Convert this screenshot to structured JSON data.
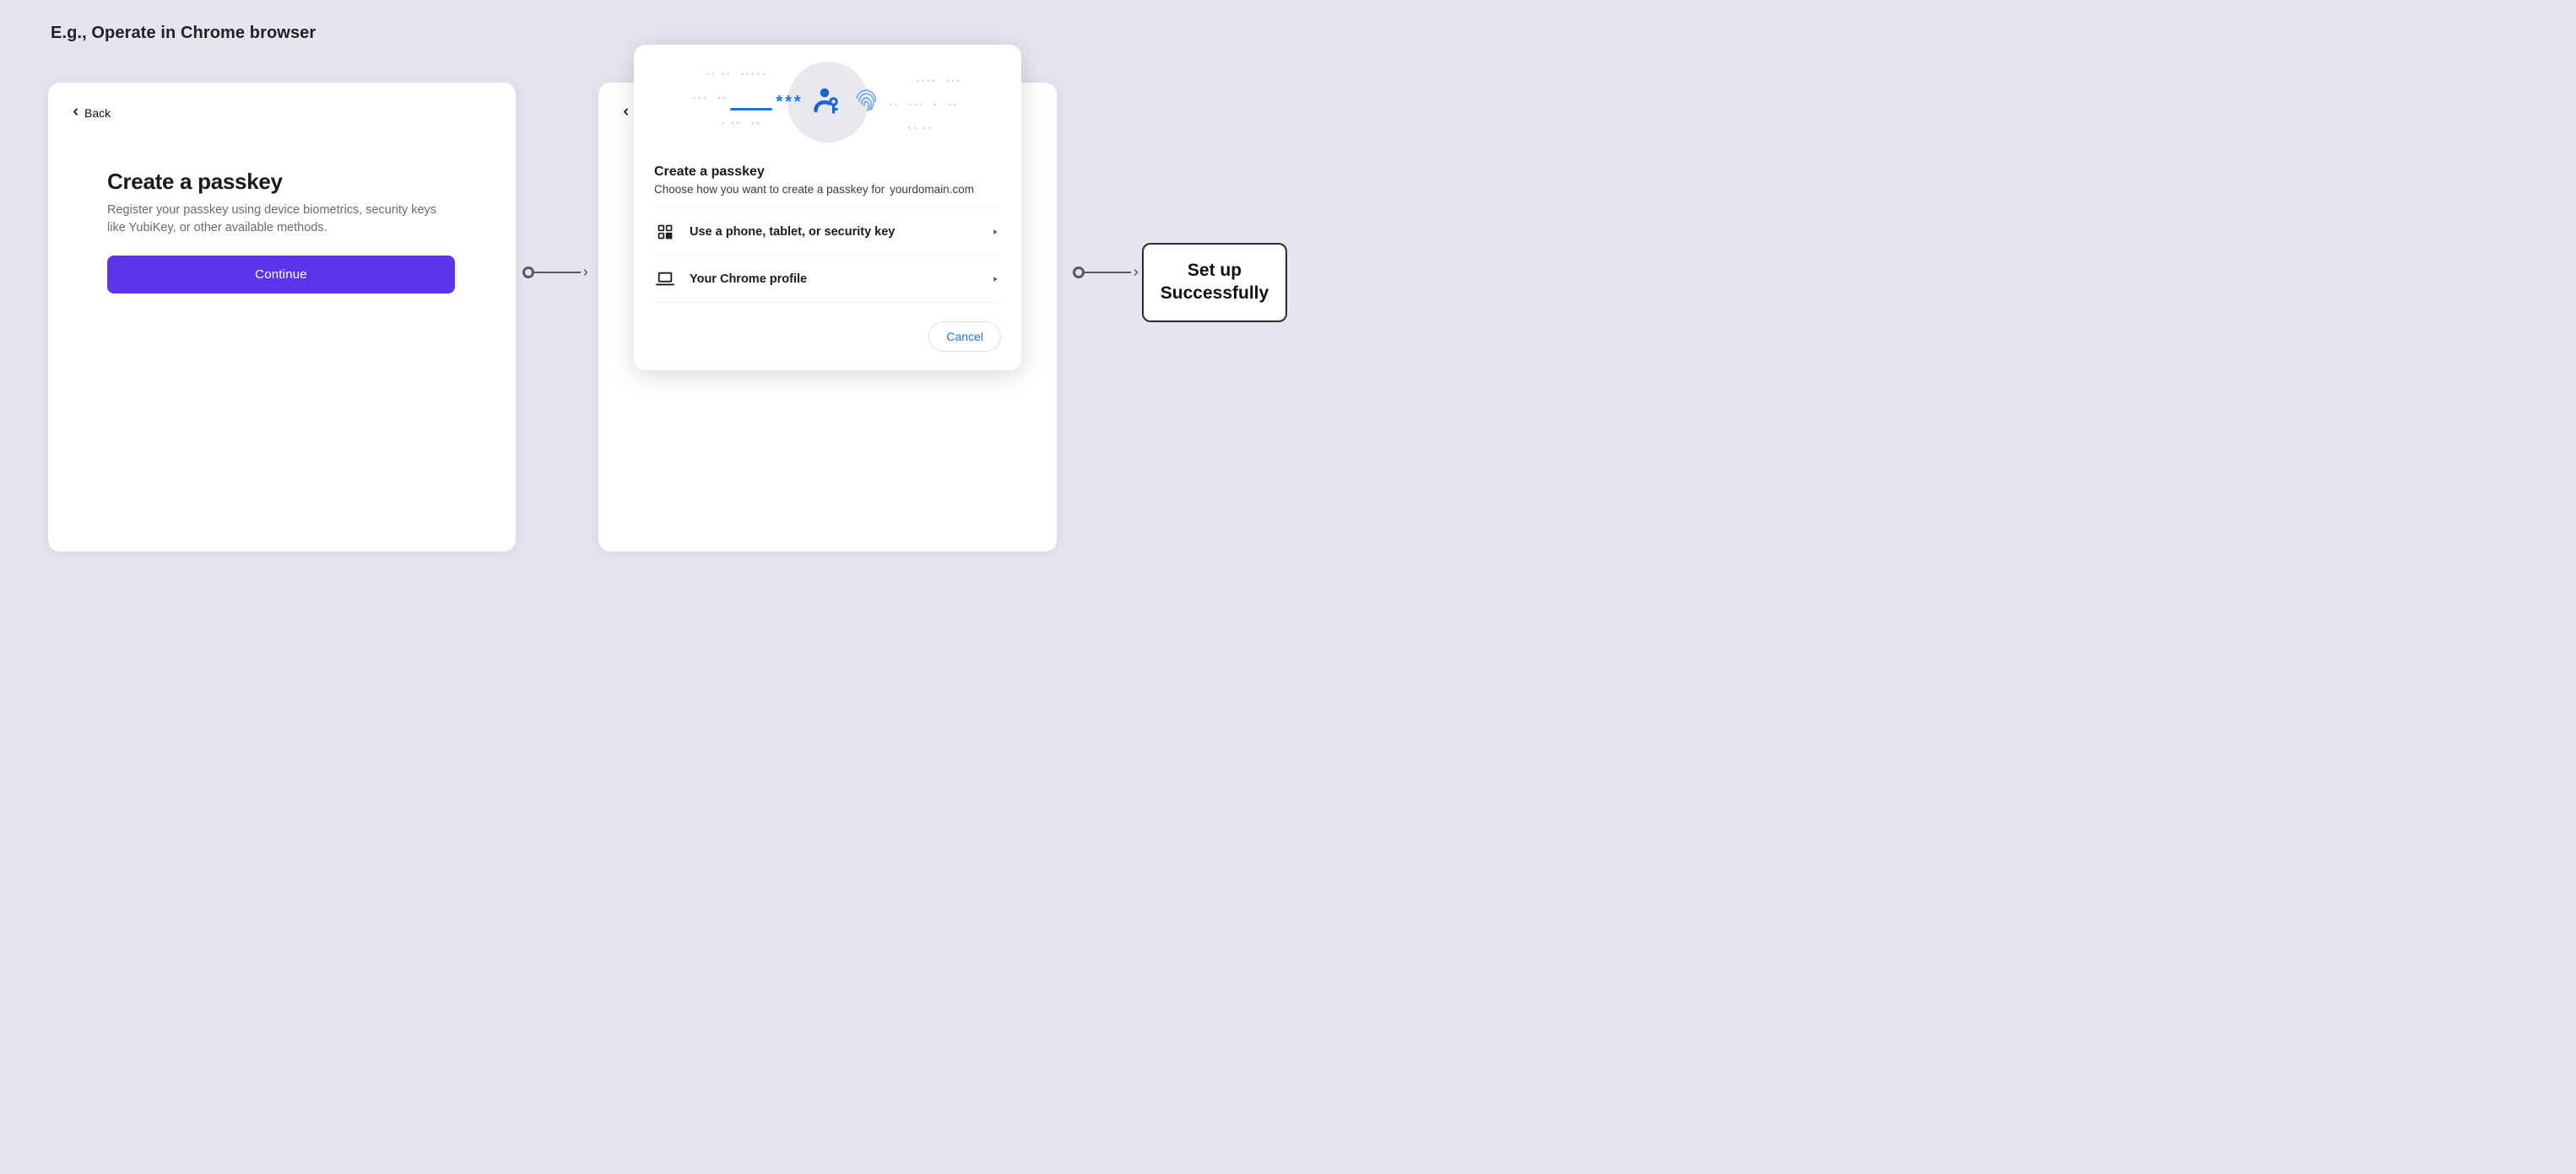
{
  "page_header": "E.g., Operate in Chrome browser",
  "card1": {
    "back_label": "Back",
    "title": "Create a passkey",
    "description": "Register your passkey using device biometrics, security keys like YubiKey, or other available methods.",
    "continue_label": "Continue"
  },
  "card2": {
    "back_label": "Back"
  },
  "chrome_dialog": {
    "title": "Create a passkey",
    "subtitle_prefix": "Choose how you want to create a passkey for",
    "domain": "yourdomain.com",
    "options": [
      {
        "icon": "qr-icon",
        "label": "Use a phone, tablet, or security key"
      },
      {
        "icon": "laptop-icon",
        "label": "Your Chrome profile"
      }
    ],
    "cancel_label": "Cancel"
  },
  "success_label": "Set up Successfully"
}
